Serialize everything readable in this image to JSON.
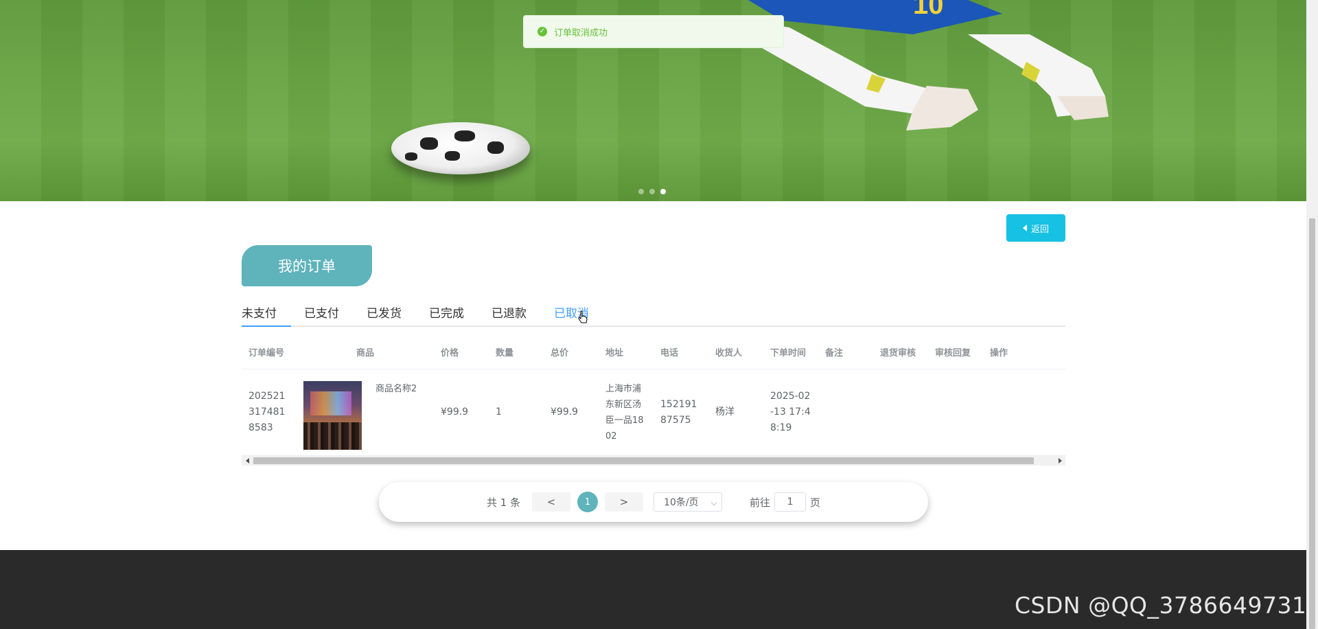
{
  "toast": {
    "icon": "check-circle-icon",
    "message": "订单取消成功"
  },
  "banner": {
    "slides": 3,
    "active_slide": 3
  },
  "back_button": {
    "label": "返回",
    "icon": "caret-left-icon"
  },
  "page_title": "我的订单",
  "tabs": [
    {
      "label": "未支付"
    },
    {
      "label": "已支付"
    },
    {
      "label": "已发货"
    },
    {
      "label": "已完成"
    },
    {
      "label": "已退款"
    },
    {
      "label": "已取消",
      "active": true
    }
  ],
  "table": {
    "headers": [
      "订单编号",
      "商品",
      "价格",
      "数量",
      "总价",
      "地址",
      "电话",
      "收货人",
      "下单时间",
      "备注",
      "退货审核",
      "审核回复",
      "操作"
    ],
    "rows": [
      {
        "order_no": "202521317481 8583",
        "product_name": "商品名称2",
        "price": "¥99.9",
        "quantity": "1",
        "total": "¥99.9",
        "address": "上海市浦东新区汤臣一品1802",
        "phone": "15219187575",
        "receiver": "杨洋",
        "order_time": "2025-02-13 17:48:19",
        "remark": "",
        "return_review": "",
        "review_reply": "",
        "actions": ""
      }
    ]
  },
  "pagination": {
    "total_text": "共 1 条",
    "prev": "<",
    "next": ">",
    "current_page": "1",
    "page_size": "10条/页",
    "goto_prefix": "前往",
    "goto_value": "1",
    "goto_suffix": "页"
  },
  "watermark": "CSDN @QQ_3786649731",
  "colors": {
    "accent": "#5fb3bb",
    "back_button": "#17c1e3",
    "active_tab": "#409eff",
    "footer": "#2a2a2a",
    "toast_bg": "#f0f9eb",
    "toast_text": "#67c23a"
  }
}
